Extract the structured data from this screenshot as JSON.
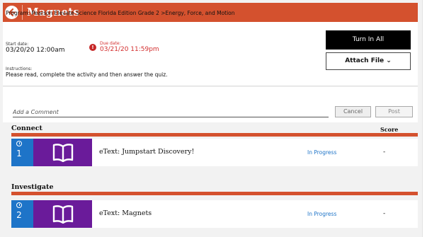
{
  "header": {
    "title": "Magnets"
  },
  "assignment": {
    "program": "Program: Pearson Elevate Science Florida Edition Grade 2 >Energy, Force, and Motion",
    "start_label": "Start date:",
    "start_value": "03/20/20 12:00am",
    "due_label": "Due date:",
    "due_value": "03/21/20 11:59pm",
    "instructions_label": "Instructions:",
    "instructions_text": "Please read, complete the activity and then answer the quiz."
  },
  "actions": {
    "turn_in_label": "Turn In All",
    "attach_label": "Attach File ⌄"
  },
  "comment": {
    "placeholder": "Add a Comment",
    "cancel_label": "Cancel",
    "post_label": "Post"
  },
  "score_header": "Score",
  "sections": [
    {
      "name": "Connect",
      "items": [
        {
          "number": "1",
          "title": "eText: Jumpstart Discovery!",
          "status": "In Progress",
          "score": "-"
        }
      ]
    },
    {
      "name": "Investigate",
      "items": [
        {
          "number": "2",
          "title": "eText: Magnets",
          "status": "In Progress",
          "score": "-"
        }
      ]
    }
  ],
  "colors": {
    "brand_orange": "#d4512e",
    "tile_blue": "#1e74c8",
    "tile_purple": "#6a1b9a",
    "due_red": "#d32f2f"
  }
}
